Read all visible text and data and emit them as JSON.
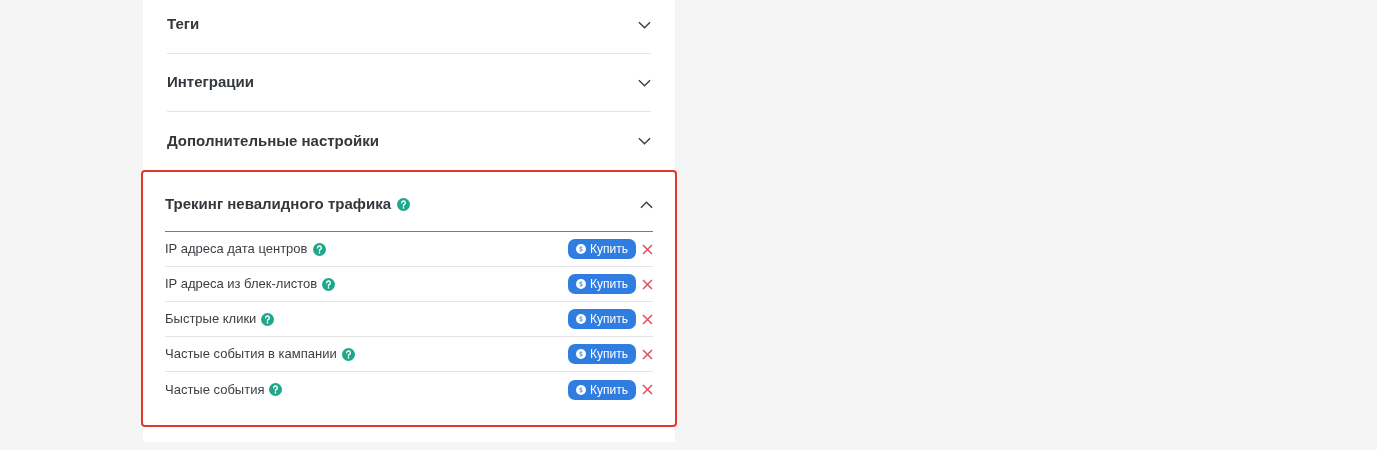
{
  "sections": [
    {
      "title": "Теги",
      "expanded": false
    },
    {
      "title": "Интеграции",
      "expanded": false
    },
    {
      "title": "Дополнительные настройки",
      "expanded": false
    },
    {
      "title": "Трекинг невалидного трафика",
      "expanded": true,
      "highlighted": true,
      "help": true,
      "items": [
        {
          "label": "IP адреса дата центров",
          "button": "Купить"
        },
        {
          "label": "IP адреса из блек-листов",
          "button": "Купить"
        },
        {
          "label": "Быстрые клики",
          "button": "Купить"
        },
        {
          "label": "Частые события в кампании",
          "button": "Купить"
        },
        {
          "label": "Частые события",
          "button": "Купить"
        }
      ]
    }
  ]
}
